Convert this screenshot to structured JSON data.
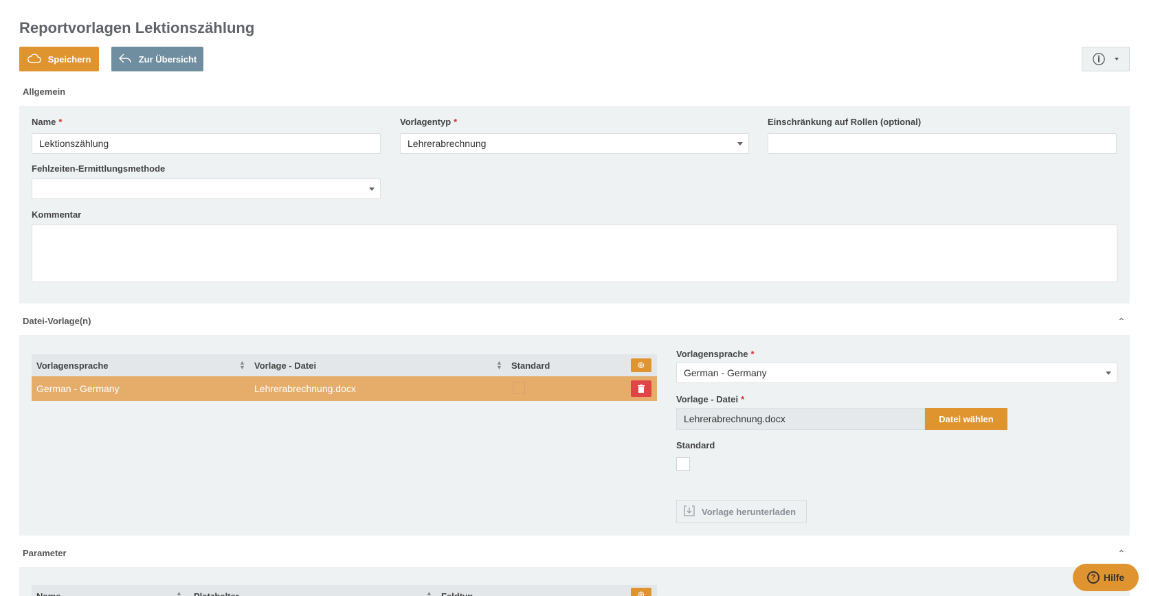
{
  "page": {
    "title": "Reportvorlagen Lektionszählung"
  },
  "toolbar": {
    "save_label": "Speichern",
    "overview_label": "Zur Übersicht",
    "info_icon": "ⓘ"
  },
  "sections": {
    "general": "Allgemein",
    "file_templates": "Datei-Vorlage(n)",
    "parameters": "Parameter"
  },
  "general": {
    "name": {
      "label": "Name",
      "value": "Lektionszählung"
    },
    "template_type": {
      "label": "Vorlagentyp",
      "value": "Lehrerabrechnung"
    },
    "role_restriction": {
      "label": "Einschränkung auf Rollen (optional)",
      "value": ""
    },
    "absence_method": {
      "label": "Fehlzeiten-Ermittlungsmethode",
      "value": ""
    },
    "comment": {
      "label": "Kommentar",
      "value": ""
    }
  },
  "file_table": {
    "columns": [
      "Vorlagensprache",
      "Vorlage - Datei",
      "Standard"
    ],
    "rows": [
      {
        "language": "German - Germany",
        "file": "Lehrerabrechnung.docx",
        "standard": false
      }
    ]
  },
  "file_detail": {
    "language": {
      "label": "Vorlagensprache",
      "value": "German - Germany"
    },
    "file": {
      "label": "Vorlage - Datei",
      "value": "Lehrerabrechnung.docx",
      "button": "Datei wählen"
    },
    "standard": {
      "label": "Standard",
      "checked": false
    },
    "download_label": "Vorlage herunterladen"
  },
  "param_table": {
    "columns": [
      "Name",
      "Platzhalter",
      "Feldtyp"
    ]
  },
  "help": {
    "label": "Hilfe"
  },
  "colors": {
    "accent": "#e0942f",
    "secondary": "#6f8fa0",
    "danger": "#e04545",
    "row_selected": "#e6ac6a",
    "panel": "#eff2f3"
  }
}
